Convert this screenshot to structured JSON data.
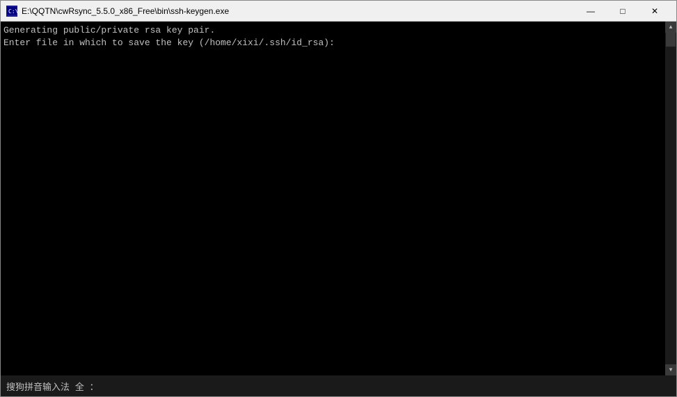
{
  "titleBar": {
    "icon": "terminal-icon",
    "title": "E:\\QQTN\\cwRsync_5.5.0_x86_Free\\bin\\ssh-keygen.exe",
    "minimizeLabel": "—",
    "maximizeLabel": "□",
    "closeLabel": "✕"
  },
  "console": {
    "line1": "Generating public/private rsa key pair.",
    "line2": "Enter file in which to save the key (/home/xixi/.ssh/id_rsa):"
  },
  "imeBar": {
    "text": "搜狗拼音输入法 全 ："
  }
}
